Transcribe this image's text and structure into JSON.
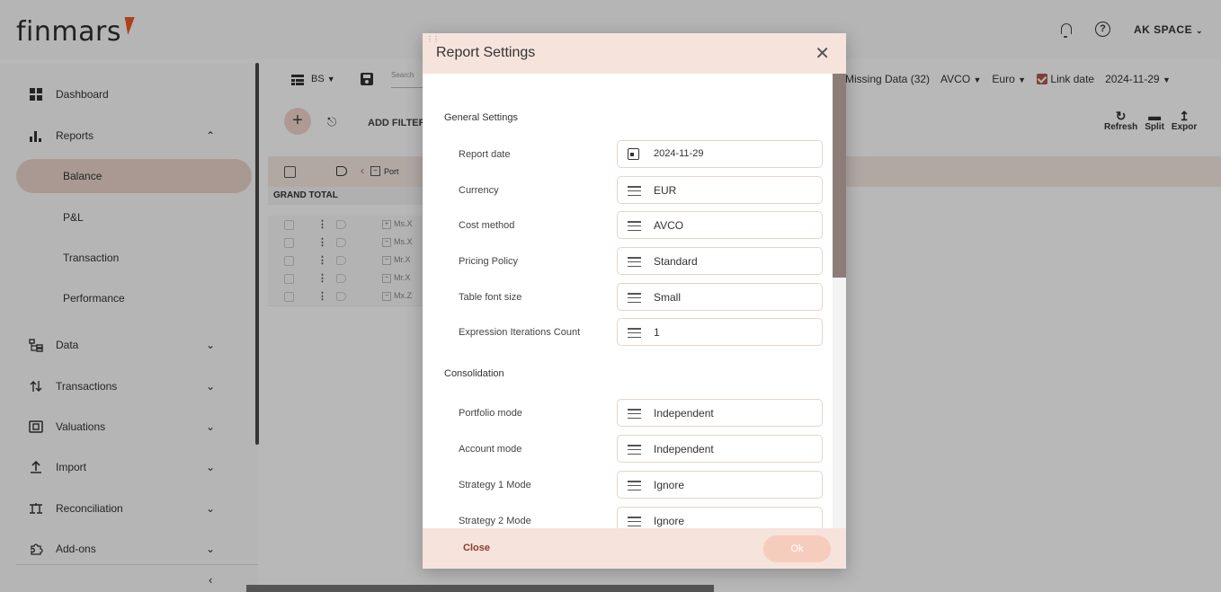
{
  "app": {
    "logo_text": "finmars",
    "space_label": "AK SPACE"
  },
  "sidebar": {
    "items": [
      {
        "label": "Dashboard",
        "icon": "dashboard-icon"
      },
      {
        "label": "Reports",
        "icon": "bar-chart-icon"
      },
      {
        "label": "Data",
        "icon": "hierarchy-icon"
      },
      {
        "label": "Transactions",
        "icon": "arrows-icon"
      },
      {
        "label": "Valuations",
        "icon": "valuation-icon"
      },
      {
        "label": "Import",
        "icon": "import-icon"
      },
      {
        "label": "Reconciliation",
        "icon": "reconciliation-icon"
      },
      {
        "label": "Add-ons",
        "icon": "puzzle-icon"
      }
    ],
    "report_subitems": [
      "Balance",
      "P&L",
      "Transaction",
      "Performance"
    ],
    "active_subitem": "Balance"
  },
  "toolbar": {
    "layout_label": "BS",
    "search_placeholder": "Search",
    "missing_data": "Missing Data (32)",
    "cost_method": "AVCO",
    "currency": "Euro",
    "link_date_label": "Link date",
    "link_date_value": "2024-11-29",
    "add_filter_label": "ADD FILTER",
    "refresh_label": "Refresh",
    "split_label": "Split",
    "export_label": "Expor",
    "portfolio_col": "Port"
  },
  "grid": {
    "grand_total": "GRAND TOTAL",
    "rows": [
      "Ms.X",
      "Ms.X",
      "Mr.X",
      "Mr.X",
      "Mx.Z"
    ]
  },
  "modal": {
    "title": "Report Settings",
    "general_section": "General Settings",
    "consolidation_section": "Consolidation",
    "general_fields": [
      {
        "label": "Report date",
        "value": "2024-11-29",
        "icon": "calendar-icon"
      },
      {
        "label": "Currency",
        "value": "EUR",
        "icon": "menu-icon"
      },
      {
        "label": "Cost method",
        "value": "AVCO",
        "icon": "menu-icon"
      },
      {
        "label": "Pricing Policy",
        "value": "Standard",
        "icon": "menu-icon"
      },
      {
        "label": "Table font size",
        "value": "Small",
        "icon": "menu-icon"
      },
      {
        "label": "Expression Iterations Count",
        "value": "1",
        "icon": "menu-icon"
      }
    ],
    "consolidation_fields": [
      {
        "label": "Portfolio mode",
        "value": "Independent"
      },
      {
        "label": "Account mode",
        "value": "Independent"
      },
      {
        "label": "Strategy 1 Mode",
        "value": "Ignore"
      },
      {
        "label": "Strategy 2 Mode",
        "value": "Ignore"
      }
    ],
    "close_label": "Close",
    "ok_label": "Ok"
  }
}
